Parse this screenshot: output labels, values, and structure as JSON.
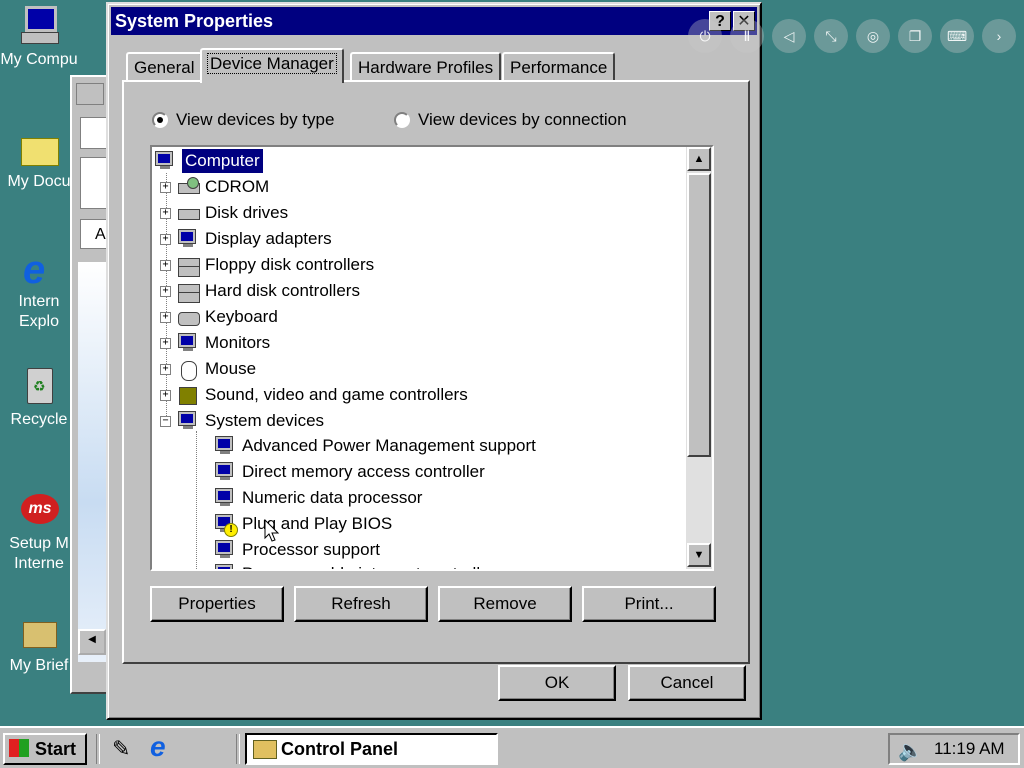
{
  "desktop": {
    "icons": [
      {
        "label": "My Compu"
      },
      {
        "label": "My Docu"
      },
      {
        "label": "Intern\nExplo"
      },
      {
        "label": "Recycle"
      },
      {
        "label": "Setup M\nInterne"
      },
      {
        "label": "My Brief"
      }
    ]
  },
  "dialog": {
    "title": "System Properties",
    "help_btn": "?",
    "close_btn": "✕",
    "tabs": [
      "General",
      "Device Manager",
      "Hardware Profiles",
      "Performance"
    ],
    "radio_by_type": "View devices by type",
    "radio_by_connection": "View devices by connection",
    "tree": {
      "root": "Computer",
      "categories": [
        "CDROM",
        "Disk drives",
        "Display adapters",
        "Floppy disk controllers",
        "Hard disk controllers",
        "Keyboard",
        "Monitors",
        "Mouse",
        "Sound, video and game controllers",
        "System devices"
      ],
      "system_devices": [
        "Advanced Power Management support",
        "Direct memory access controller",
        "Numeric data processor",
        "Plug and Play BIOS",
        "Processor support",
        "Programmable interrupt controller"
      ]
    },
    "buttons": {
      "properties": "Properties",
      "refresh": "Refresh",
      "remove": "Remove",
      "print": "Print...",
      "ok": "OK",
      "cancel": "Cancel"
    }
  },
  "background_window": {
    "letter": "A"
  },
  "taskbar": {
    "start": "Start",
    "task": "Control Panel",
    "time": "11:19 AM"
  },
  "colors": {
    "desktop": "#3a8080",
    "titlebar": "#000080",
    "selection": "#000080"
  }
}
